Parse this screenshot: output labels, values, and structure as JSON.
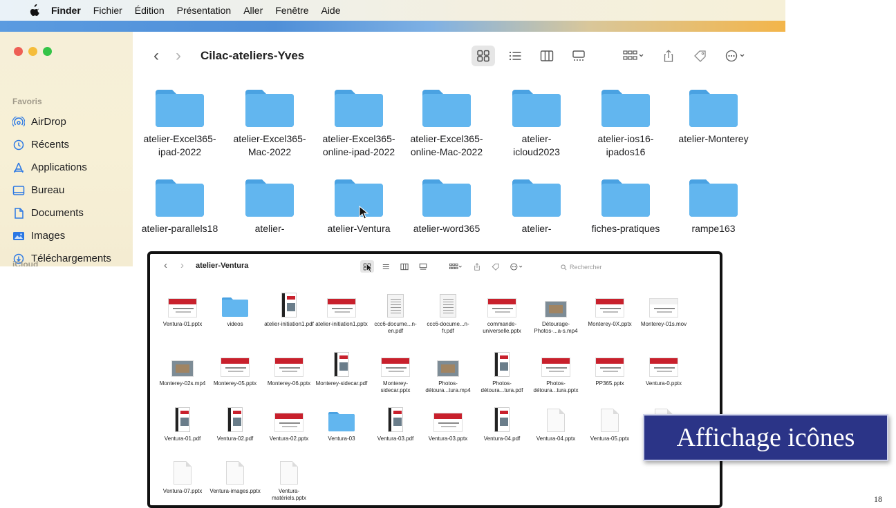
{
  "menubar": {
    "app": "Finder",
    "items": [
      "Fichier",
      "Édition",
      "Présentation",
      "Aller",
      "Fenêtre",
      "Aide"
    ]
  },
  "big_window": {
    "title": "Cilac-ateliers-Yves",
    "sidebar": {
      "section": "Favoris",
      "items": [
        {
          "label": "AirDrop",
          "icon": "airdrop-icon"
        },
        {
          "label": "Récents",
          "icon": "clock-icon"
        },
        {
          "label": "Applications",
          "icon": "applications-icon"
        },
        {
          "label": "Bureau",
          "icon": "desktop-icon"
        },
        {
          "label": "Documents",
          "icon": "document-icon"
        },
        {
          "label": "Images",
          "icon": "images-icon"
        },
        {
          "label": "Téléchargements",
          "icon": "download-icon"
        }
      ],
      "section2": "iCloud"
    },
    "folders": [
      {
        "l1": "atelier-Excel365-",
        "l2": "ipad-2022"
      },
      {
        "l1": "atelier-Excel365-",
        "l2": "Mac-2022"
      },
      {
        "l1": "atelier-Excel365-",
        "l2": "online-ipad-2022"
      },
      {
        "l1": "atelier-Excel365-",
        "l2": "online-Mac-2022"
      },
      {
        "l1": "atelier-",
        "l2": "icloud2023"
      },
      {
        "l1": "atelier-ios16-",
        "l2": "ipados16"
      },
      {
        "l1": "atelier-Monterey",
        "l2": ""
      },
      {
        "l1": "atelier-parallels18",
        "l2": ""
      },
      {
        "l1": "atelier-",
        "l2": ""
      },
      {
        "l1": "atelier-Ventura",
        "l2": ""
      },
      {
        "l1": "atelier-word365",
        "l2": ""
      },
      {
        "l1": "atelier-",
        "l2": ""
      },
      {
        "l1": "fiches-pratiques",
        "l2": ""
      },
      {
        "l1": "rampe163",
        "l2": ""
      }
    ]
  },
  "small_window": {
    "title": "atelier-Ventura",
    "search_placeholder": "Rechercher",
    "files": [
      {
        "label": "Ventura-01.pptx",
        "kind": "ppt"
      },
      {
        "label": "videos",
        "kind": "folder"
      },
      {
        "label": "atelier-initiation1.pdf",
        "kind": "pdfbook"
      },
      {
        "label": "atelier-initiation1.pptx",
        "kind": "ppt"
      },
      {
        "label": "ccc6-docume...n-en.pdf",
        "kind": "pdfdoc"
      },
      {
        "label": "ccc6-docume...n-fr.pdf",
        "kind": "pdfdoc"
      },
      {
        "label": "commande-universelle.pptx",
        "kind": "ppt"
      },
      {
        "label": "Détourage-Photos-...a-s.mp4",
        "kind": "video"
      },
      {
        "label": "Monterey-0X.pptx",
        "kind": "ppt"
      },
      {
        "label": "Monterey-01s.mov",
        "kind": "pptwhite"
      },
      {
        "label": "Monterey-02s.mp4",
        "kind": "video"
      },
      {
        "label": "Monterey-05.pptx",
        "kind": "ppt"
      },
      {
        "label": "Monterey-06.pptx",
        "kind": "ppt"
      },
      {
        "label": "Monterey-sidecar.pdf",
        "kind": "pdfbook"
      },
      {
        "label": "Monterey-sidecar.pptx",
        "kind": "ppt"
      },
      {
        "label": "Photos-détoura...tura.mp4",
        "kind": "video"
      },
      {
        "label": "Photos-détoura...tura.pdf",
        "kind": "pdfbook"
      },
      {
        "label": "Photos-détoura...tura.pptx",
        "kind": "ppt"
      },
      {
        "label": "PP365.pptx",
        "kind": "ppt"
      },
      {
        "label": "Ventura-0.pptx",
        "kind": "ppt"
      },
      {
        "label": "Ventura-01.pdf",
        "kind": "pdfbook"
      },
      {
        "label": "Ventura-02.pdf",
        "kind": "pdfbook"
      },
      {
        "label": "Ventura-02.pptx",
        "kind": "ppt"
      },
      {
        "label": "Ventura-03",
        "kind": "folder"
      },
      {
        "label": "Ventura-03.pdf",
        "kind": "pdfbook"
      },
      {
        "label": "Ventura-03.pptx",
        "kind": "ppt"
      },
      {
        "label": "Ventura-04.pdf",
        "kind": "pdfbook"
      },
      {
        "label": "Ventura-04.pptx",
        "kind": "blank"
      },
      {
        "label": "Ventura-05.pptx",
        "kind": "blank"
      },
      {
        "label": "",
        "kind": "blank"
      },
      {
        "label": "Ventura-07.pptx",
        "kind": "blank"
      },
      {
        "label": "Ventura-images.pptx",
        "kind": "blank"
      },
      {
        "label": "Ventura-matériels.pptx",
        "kind": "blank"
      }
    ]
  },
  "caption": "Affichage icônes",
  "page_number": "18",
  "colors": {
    "folder": "#5aaee8",
    "caption_bg": "#2b3487",
    "ppt_band": "#c8202c"
  }
}
